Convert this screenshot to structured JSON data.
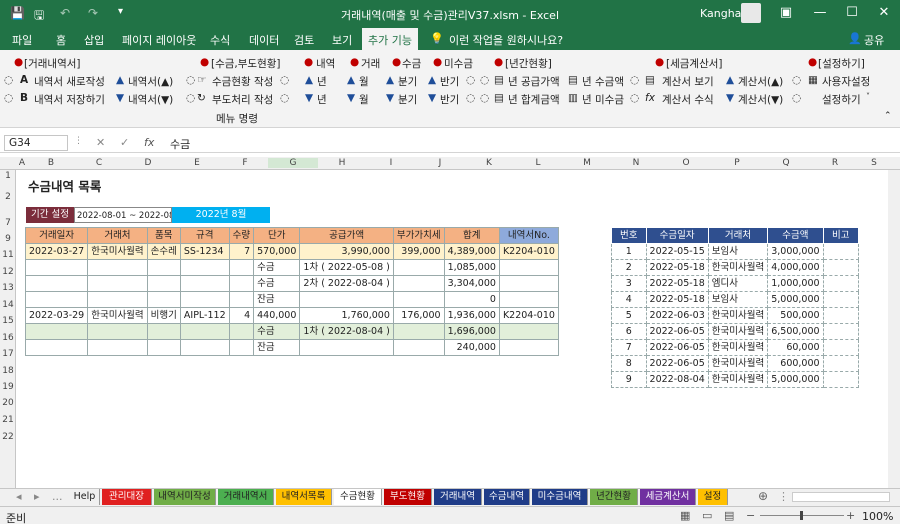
{
  "window": {
    "title": "거래내역(매출 및 수금)관리V37.xlsm  -  Excel",
    "user": "Kangha",
    "minimize": "—",
    "restore": "☐",
    "close": "✕",
    "ribbon_opt": "▣"
  },
  "qa": {
    "save": "💾",
    "print": "🖫",
    "undo": "↶",
    "redo": "↷",
    "more": "▾"
  },
  "menu": [
    "파일",
    "홈",
    "삽입",
    "페이지 레이아웃",
    "수식",
    "데이터",
    "검토",
    "보기",
    "추가 기능",
    "이런 작업을 원하시나요?"
  ],
  "menu_share": "공유",
  "ribbon": {
    "g1": "[거래내역서]",
    "g1_a": "내역서 새로작성",
    "g1_b": "내역서 저장하기",
    "g1_c": "내역서(▲)",
    "g1_d": "내역서(▼)",
    "g2": "[수금,부도현황]",
    "g2_a": "수금현황 작성",
    "g2_b": "부도처리 작성",
    "g3a": "내역",
    "g3b": "거래",
    "g3c": "수금",
    "g3d": "미수금",
    "g3_up1": "년",
    "g3_up2": "월",
    "g3_up3": "분기",
    "g3_up4": "반기",
    "g3_dn1": "년",
    "g3_dn2": "월",
    "g3_dn3": "분기",
    "g3_dn4": "반기",
    "g4": "[년간현황]",
    "g4_a": "년 공급가액",
    "g4_b": "년 합계금액",
    "g4_c": "년 수금액",
    "g4_d": "년 미수금",
    "g5": "[세금계산서]",
    "g5_a": "계산서 보기",
    "g5_b": "계산서 수식",
    "g5_c": "계산서(▲)",
    "g5_d": "계산서(▼)",
    "g6": "[설정하기]",
    "g6_a": "사용자설정",
    "g6_b": "설정하기",
    "footer": "메뉴 명령",
    "letter_a": "A",
    "letter_b": "B"
  },
  "formula": {
    "namebox": "G34",
    "fx": "fx",
    "cancel": "✕",
    "enter": "✓",
    "value": "수금"
  },
  "cols": [
    "A",
    "B",
    "C",
    "D",
    "E",
    "F",
    "G",
    "H",
    "I",
    "J",
    "K",
    "L",
    "M",
    "N",
    "O",
    "P",
    "Q",
    "R",
    "S"
  ],
  "rows": [
    "1",
    "2",
    "3",
    "4",
    "5",
    "6",
    "7",
    "8",
    "9",
    "10",
    "11",
    "12",
    "13",
    "14",
    "15",
    "16",
    "17",
    "18",
    "19",
    "20",
    "21",
    "22"
  ],
  "sheet": {
    "title": "수금내역 목록",
    "period_label": "기간 설정",
    "period_value": "2022-08-01 ~ 2022-08-31",
    "period_month": "2022년 8월",
    "left_headers": [
      "거래일자",
      "거래처",
      "품목",
      "규격",
      "수량",
      "단가",
      "공급가액",
      "부가가치세",
      "합계",
      "내역서No."
    ],
    "left_rows": [
      [
        "2022-03-27",
        "한국미사월력",
        "손수레",
        "SS-1234",
        "7",
        "570,000",
        "3,990,000",
        "399,000",
        "4,389,000",
        "K2204-010"
      ],
      [
        "",
        "",
        "",
        "",
        "",
        "수금",
        "1차 ( 2022-05-08 )",
        "",
        "1,085,000",
        ""
      ],
      [
        "",
        "",
        "",
        "",
        "",
        "수금",
        "2차 ( 2022-08-04 )",
        "",
        "3,304,000",
        ""
      ],
      [
        "",
        "",
        "",
        "",
        "",
        "잔금",
        "",
        "",
        "0",
        ""
      ],
      [
        "2022-03-29",
        "한국미사월력",
        "비행기",
        "AIPL-112",
        "4",
        "440,000",
        "1,760,000",
        "176,000",
        "1,936,000",
        "K2204-010"
      ],
      [
        "",
        "",
        "",
        "",
        "",
        "수금",
        "1차 ( 2022-08-04 )",
        "",
        "1,696,000",
        ""
      ],
      [
        "",
        "",
        "",
        "",
        "",
        "잔금",
        "",
        "",
        "240,000",
        ""
      ]
    ],
    "right_headers": [
      "번호",
      "수금일자",
      "거래처",
      "수금액",
      "비고"
    ],
    "right_rows": [
      [
        "1",
        "2022-05-15",
        "보임사",
        "3,000,000",
        ""
      ],
      [
        "2",
        "2022-05-18",
        "한국미사월력",
        "4,000,000",
        ""
      ],
      [
        "3",
        "2022-05-18",
        "엠디사",
        "1,000,000",
        ""
      ],
      [
        "4",
        "2022-05-18",
        "보임사",
        "5,000,000",
        ""
      ],
      [
        "5",
        "2022-06-03",
        "한국미사월력",
        "500,000",
        ""
      ],
      [
        "6",
        "2022-06-05",
        "한국미사월력",
        "6,500,000",
        ""
      ],
      [
        "7",
        "2022-06-05",
        "한국미사월력",
        "60,000",
        ""
      ],
      [
        "8",
        "2022-06-05",
        "한국미사월력",
        "600,000",
        ""
      ],
      [
        "9",
        "2022-08-04",
        "한국미사월력",
        "5,000,000",
        ""
      ]
    ]
  },
  "tabs": [
    {
      "label": "Help",
      "color": "#f0f0f0",
      "fg": "#222"
    },
    {
      "label": "관리대장",
      "color": "#e02020",
      "fg": "#fff"
    },
    {
      "label": "내역서미작성",
      "color": "#70ad47",
      "fg": "#222"
    },
    {
      "label": "거래내역서",
      "color": "#4caf50",
      "fg": "#222"
    },
    {
      "label": "내역서목록",
      "color": "#ffc000",
      "fg": "#222"
    },
    {
      "label": "수금현황",
      "color": "#ffffff",
      "fg": "#222"
    },
    {
      "label": "부도현황",
      "color": "#c00000",
      "fg": "#fff"
    },
    {
      "label": "거래내역",
      "color": "#1f3c88",
      "fg": "#fff"
    },
    {
      "label": "수금내역",
      "color": "#1f3c88",
      "fg": "#fff"
    },
    {
      "label": "미수금내역",
      "color": "#1f3c88",
      "fg": "#fff"
    },
    {
      "label": "년간현황",
      "color": "#70ad47",
      "fg": "#222"
    },
    {
      "label": "세금계산서",
      "color": "#7030a0",
      "fg": "#fff"
    },
    {
      "label": "설정",
      "color": "#ffc000",
      "fg": "#222"
    }
  ],
  "tab_nav": {
    "prev": "◂",
    "next": "▸",
    "dots": "...",
    "add": "⊕"
  },
  "status": {
    "ready": "준비",
    "zoom": "100%",
    "minus": "−",
    "plus": "+"
  }
}
